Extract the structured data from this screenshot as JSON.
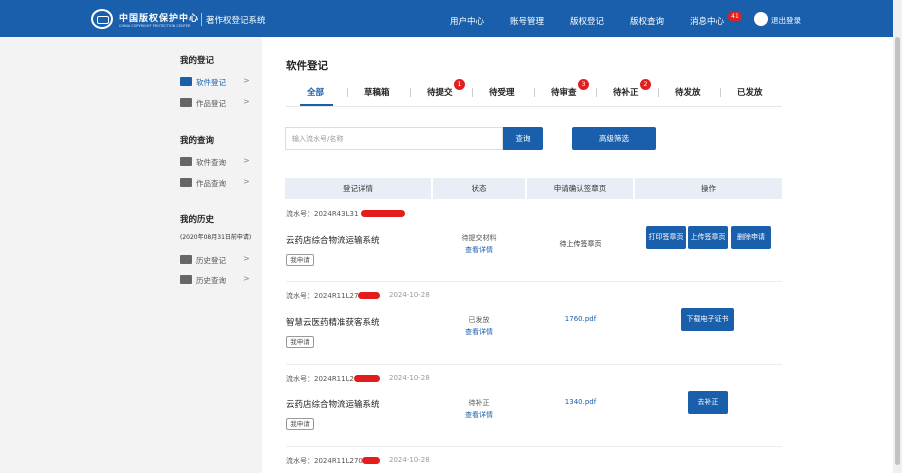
{
  "header": {
    "brand_cn": "中国版权保护中心",
    "brand_en": "CHINA COPYRIGHT PROTECTION CENTER",
    "app_title": "著作权登记系统",
    "nav": [
      "用户中心",
      "账号管理",
      "版权登记",
      "版权查询",
      "消息中心"
    ],
    "message_count": "41",
    "logout": "退出登录"
  },
  "sidebar": {
    "my_registrations": {
      "title": "我的登记",
      "items": [
        {
          "label": "软件登记",
          "icon": "software-icon",
          "active": true
        },
        {
          "label": "作品登记",
          "icon": "works-icon",
          "active": false
        }
      ]
    },
    "my_queries": {
      "title": "我的查询",
      "items": [
        {
          "label": "软件查询",
          "icon": "software-icon"
        },
        {
          "label": "作品查询",
          "icon": "works-icon"
        }
      ]
    },
    "my_history": {
      "title": "我的历史",
      "note": "(2020年08月31日前申请)",
      "items": [
        {
          "label": "历史登记",
          "icon": "history-icon"
        },
        {
          "label": "历史查询",
          "icon": "history-icon"
        }
      ]
    },
    "arrow": ">"
  },
  "main": {
    "title": "软件登记",
    "tabs": [
      {
        "label": "全部",
        "badge": null,
        "active": true
      },
      {
        "label": "草稿箱",
        "badge": null
      },
      {
        "label": "待提交",
        "badge": "1"
      },
      {
        "label": "待受理",
        "badge": null
      },
      {
        "label": "待审查",
        "badge": "3"
      },
      {
        "label": "待补正",
        "badge": "2"
      },
      {
        "label": "待发放",
        "badge": null
      },
      {
        "label": "已发放",
        "badge": null
      }
    ],
    "search": {
      "placeholder": "输入流水号/名称",
      "button": "查询",
      "advanced": "高级筛选"
    },
    "table": {
      "headers": [
        "登记详情",
        "状态",
        "申请确认签章页",
        "操作"
      ]
    },
    "records": [
      {
        "serial": "流水号：2024R43L31",
        "date": "",
        "name": "云药店综合物流运输系统",
        "tag": "我申请",
        "status": "待提交材料",
        "detail_link": "查看详情",
        "confirm": "待上传签章页",
        "actions": [
          "打印签章页",
          "上传签章页",
          "删除申请"
        ]
      },
      {
        "serial": "流水号：2024R11L27",
        "date": "2024-10-28",
        "name": "智慧云医药精准获客系统",
        "tag": "我申请",
        "status": "已发放",
        "detail_link": "查看详情",
        "confirm": "1760.pdf",
        "actions": [
          "下载电子证书"
        ]
      },
      {
        "serial": "流水号：2024R11L2",
        "date": "2024-10-28",
        "name": "云药店综合物流运输系统",
        "tag": "我申请",
        "status": "待补正",
        "detail_link": "查看详情",
        "confirm": "1340.pdf",
        "actions": [
          "去补正"
        ]
      },
      {
        "serial": "流水号：2024R11L270",
        "date": "2024-10-28"
      }
    ]
  },
  "colors": {
    "primary": "#1a5fab",
    "badge": "#e02020"
  }
}
